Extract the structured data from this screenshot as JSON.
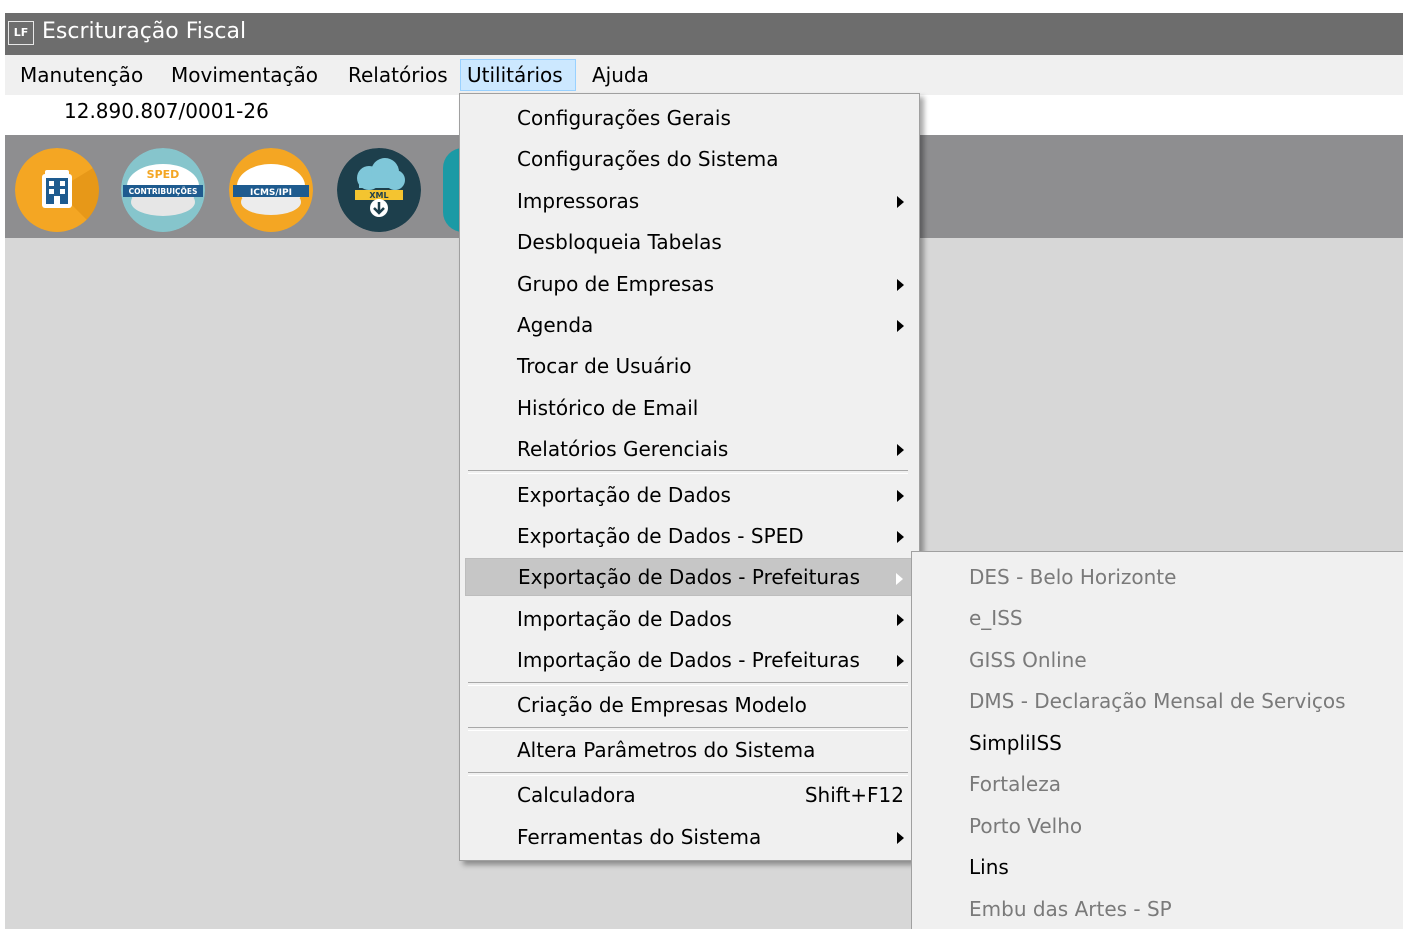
{
  "window": {
    "icon_text": "LF",
    "title": "Escrituração Fiscal"
  },
  "menubar": [
    {
      "label": "Manutenção"
    },
    {
      "label": "Movimentação"
    },
    {
      "label": "Relatórios"
    },
    {
      "label": "Utilitários",
      "active": true
    },
    {
      "label": "Ajuda"
    }
  ],
  "company": {
    "cnpj": "12.890.807/0001-26"
  },
  "toolbar": {
    "buttons": [
      {
        "icon": "building-icon",
        "color": "#f4a623"
      },
      {
        "icon": "sped-contribuicoes-icon",
        "color": "#86c5cc",
        "text": "SPED",
        "subtext": "CONTRIBUIÇÕES"
      },
      {
        "icon": "icms-ipi-icon",
        "color": "#f4a623",
        "text": "ICMS/IPI"
      },
      {
        "icon": "xml-download-icon",
        "color": "#1d3f4c",
        "text": "XML"
      }
    ]
  },
  "utilitarios_menu": [
    {
      "label": "Configurações Gerais"
    },
    {
      "label": "Configurações do Sistema"
    },
    {
      "label": "Impressoras",
      "submenu": true
    },
    {
      "label": "Desbloqueia Tabelas"
    },
    {
      "label": "Grupo de Empresas",
      "submenu": true
    },
    {
      "label": "Agenda",
      "submenu": true
    },
    {
      "label": "Trocar de Usuário"
    },
    {
      "label": "Histórico de Email"
    },
    {
      "label": "Relatórios Gerenciais",
      "submenu": true
    },
    {
      "label": "Exportação de Dados",
      "submenu": true
    },
    {
      "label": "Exportação de Dados - SPED",
      "submenu": true
    },
    {
      "label": "Exportação de Dados - Prefeituras",
      "submenu": true,
      "highlighted": true
    },
    {
      "label": "Importação de Dados",
      "submenu": true
    },
    {
      "label": "Importação de Dados - Prefeituras",
      "submenu": true
    },
    {
      "label": "Criação de Empresas Modelo"
    },
    {
      "label": "Altera Parâmetros do Sistema"
    },
    {
      "label": "Calculadora",
      "shortcut": "Shift+F12"
    },
    {
      "label": "Ferramentas do Sistema",
      "submenu": true
    }
  ],
  "prefeituras_submenu": [
    {
      "label": "DES - Belo Horizonte",
      "enabled": false
    },
    {
      "label": "e_ISS",
      "enabled": false
    },
    {
      "label": "GISS Online",
      "enabled": false
    },
    {
      "label": "DMS - Declaração Mensal de Serviços",
      "enabled": false
    },
    {
      "label": "SimpliISS",
      "enabled": true
    },
    {
      "label": "Fortaleza",
      "enabled": false
    },
    {
      "label": "Porto Velho",
      "enabled": false
    },
    {
      "label": "Lins",
      "enabled": true
    },
    {
      "label": "Embu das Artes - SP",
      "enabled": false
    }
  ]
}
